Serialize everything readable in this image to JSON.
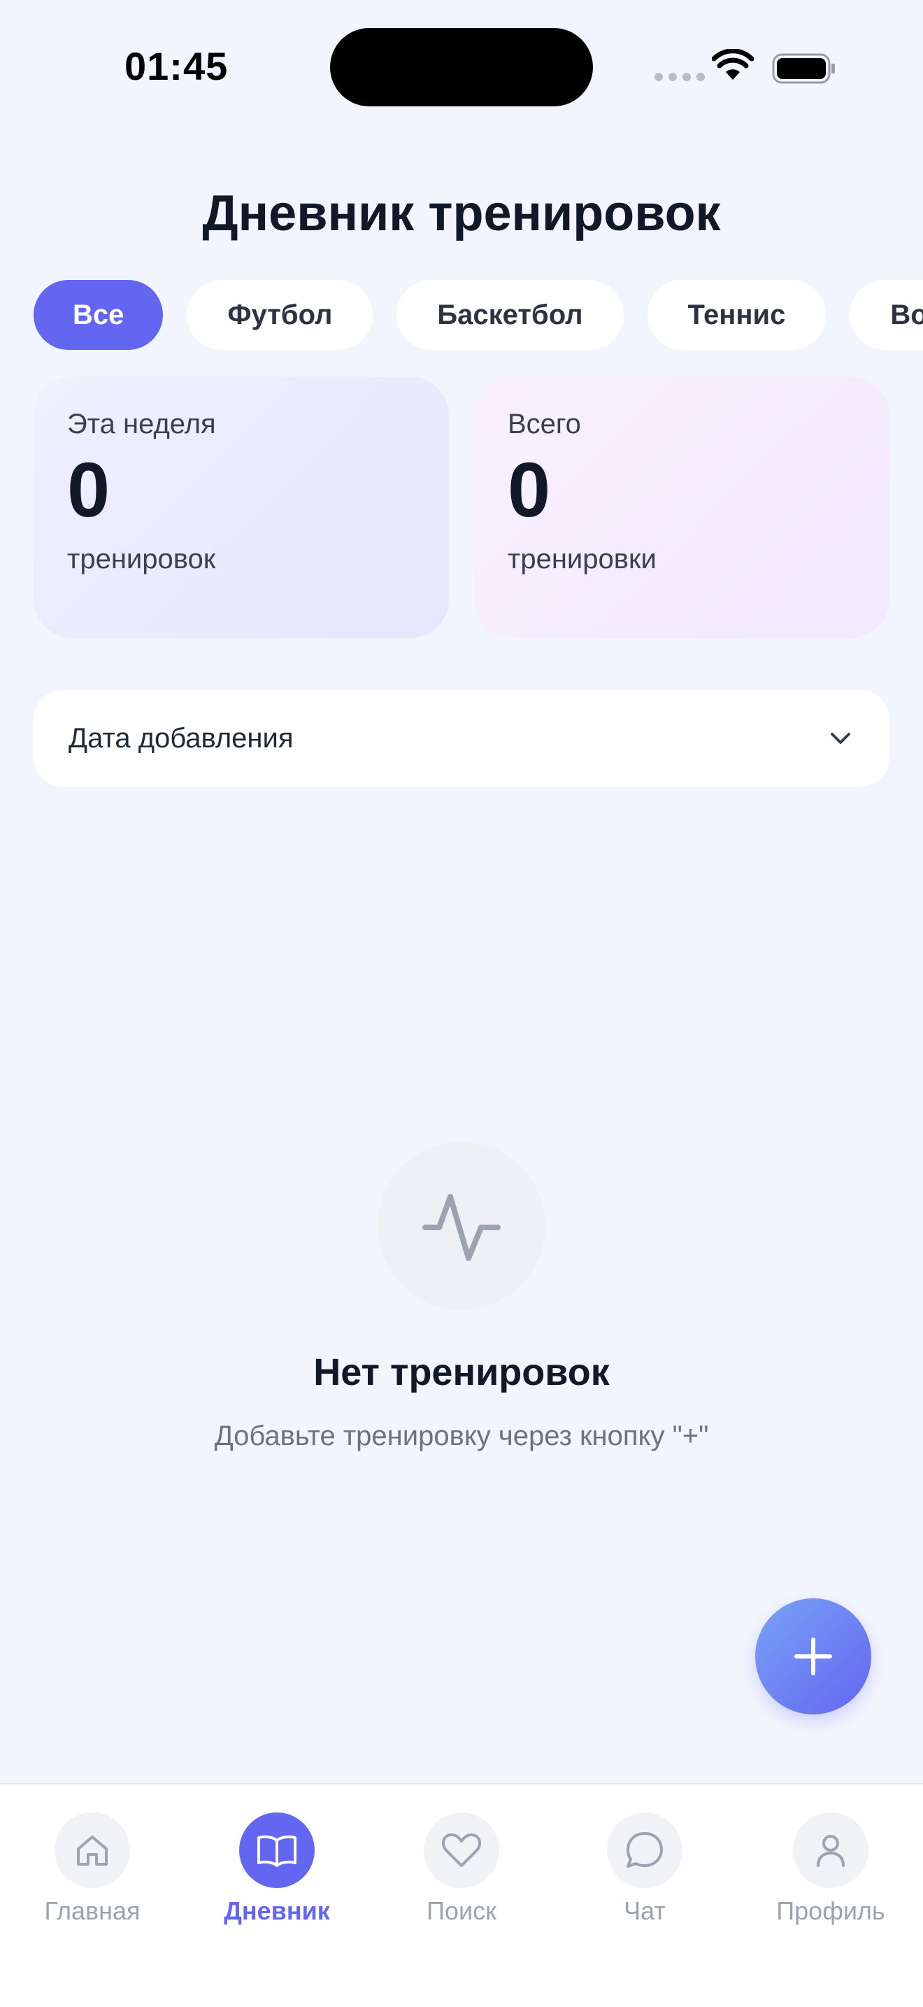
{
  "status": {
    "time": "01:45"
  },
  "header": {
    "title": "Дневник тренировок"
  },
  "filters": {
    "items": [
      {
        "label": "Все",
        "active": true
      },
      {
        "label": "Футбол",
        "active": false
      },
      {
        "label": "Баскетбол",
        "active": false
      },
      {
        "label": "Теннис",
        "active": false
      },
      {
        "label": "Волейбол",
        "active": false
      }
    ]
  },
  "stats": {
    "week": {
      "label": "Эта неделя",
      "value": "0",
      "unit": "тренировок"
    },
    "total": {
      "label": "Всего",
      "value": "0",
      "unit": "тренировки"
    }
  },
  "sort": {
    "label": "Дата добавления",
    "icon": "chevron-down-icon"
  },
  "empty_state": {
    "icon": "activity-icon",
    "title": "Нет тренировок",
    "subtitle": "Добавьте тренировку через кнопку \"+\""
  },
  "fab": {
    "icon": "plus-icon"
  },
  "tabbar": {
    "items": [
      {
        "label": "Главная",
        "icon": "home-icon",
        "active": false
      },
      {
        "label": "Дневник",
        "icon": "book-icon",
        "active": true
      },
      {
        "label": "Поиск",
        "icon": "heart-icon",
        "active": false
      },
      {
        "label": "Чат",
        "icon": "chat-icon",
        "active": false
      },
      {
        "label": "Профиль",
        "icon": "user-icon",
        "active": false
      }
    ]
  },
  "colors": {
    "accent": "#6366f1",
    "background": "#f3f5fe",
    "text_primary": "#111827",
    "text_muted": "#6b7280"
  }
}
